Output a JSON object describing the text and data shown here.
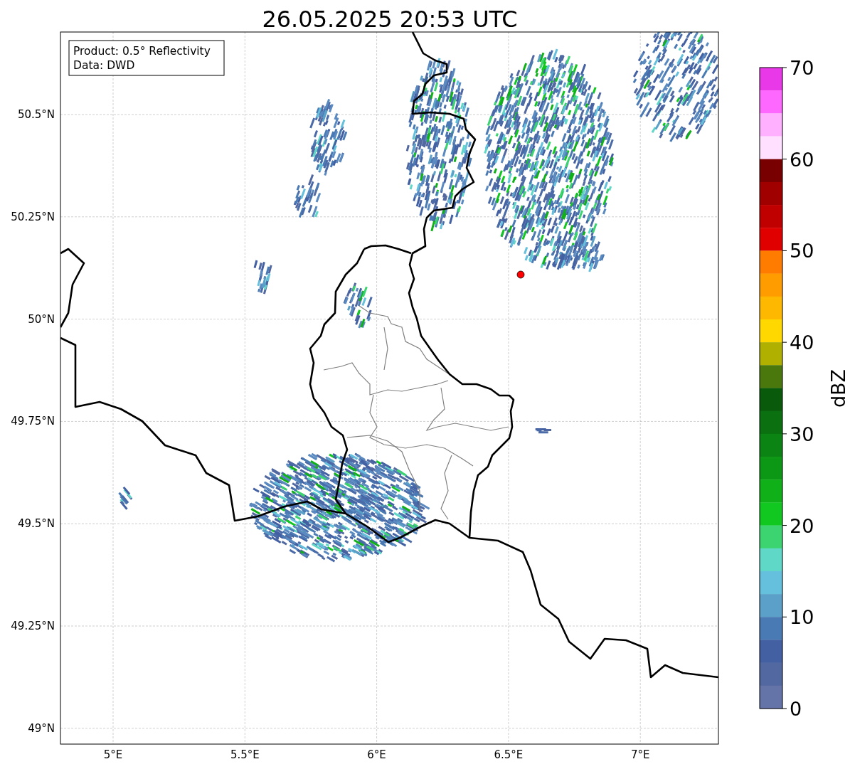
{
  "title": "26.05.2025 20:53 UTC",
  "info_box": {
    "lines": [
      "Product: 0.5° Reflectivity",
      "Data: DWD"
    ]
  },
  "map": {
    "lat_labels": [
      "50.5°N",
      "50.25°N",
      "50°N",
      "49.75°N",
      "49.5°N",
      "49.25°N",
      "49°N"
    ],
    "lon_labels": [
      "5°E",
      "5.5°E",
      "6°E",
      "6.5°E",
      "7°E"
    ]
  },
  "colorbar": {
    "label": "dBZ",
    "ticks": [
      "70",
      "60",
      "50",
      "40",
      "30",
      "20",
      "10",
      "0"
    ],
    "bins": [
      {
        "color": "#e838e8"
      },
      {
        "color": "#ff68ff"
      },
      {
        "color": "#ffb0ff"
      },
      {
        "color": "#ffe0ff"
      },
      {
        "color": "#780000"
      },
      {
        "color": "#a00000"
      },
      {
        "color": "#c00000"
      },
      {
        "color": "#e00000"
      },
      {
        "color": "#ff7c00"
      },
      {
        "color": "#ff9c00"
      },
      {
        "color": "#ffb800"
      },
      {
        "color": "#ffd800"
      },
      {
        "color": "#b0b000"
      },
      {
        "color": "#4a780c"
      },
      {
        "color": "#0a5a0c"
      },
      {
        "color": "#0a7010"
      },
      {
        "color": "#0c8414"
      },
      {
        "color": "#0c9814"
      },
      {
        "color": "#10b018"
      },
      {
        "color": "#10c820"
      },
      {
        "color": "#3cd470"
      },
      {
        "color": "#60d8c8"
      },
      {
        "color": "#64c0dc"
      },
      {
        "color": "#5aa0c8"
      },
      {
        "color": "#4a7ab4"
      },
      {
        "color": "#4360a2"
      },
      {
        "color": "#5268a0"
      },
      {
        "color": "#6474a8"
      }
    ]
  }
}
